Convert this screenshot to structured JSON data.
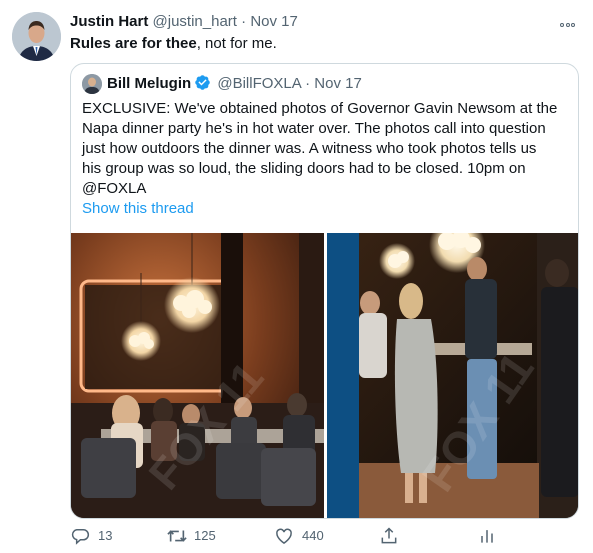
{
  "tweet": {
    "author_name": "Justin Hart",
    "author_handle": "@justin_hart",
    "separator": "·",
    "date": "Nov 17",
    "text_bold": "Rules are for thee",
    "text_rest": ", not for me."
  },
  "quoted": {
    "author_name": "Bill Melugin",
    "author_handle": "@BillFOXLA",
    "separator": "·",
    "date": "Nov 17",
    "verified": true,
    "text_lines": [
      "EXCLUSIVE: We've obtained photos of Governor Gavin Newsom at the",
      "Napa dinner party he's in hot water over. The photos call into question",
      "just how outdoors the dinner was. A witness who took photos tells us",
      "his group was so loud, the sliding doors had to be closed. 10pm on",
      "@FOXLA"
    ],
    "show_thread": "Show this thread",
    "photo_watermark": "FOX 11"
  },
  "actions": {
    "reply_count": "13",
    "retweet_count": "125",
    "like_count": "440"
  },
  "icons": {
    "more": "more-icon",
    "reply": "reply-icon",
    "retweet": "retweet-icon",
    "like": "heart-icon",
    "share": "share-icon",
    "analytics": "analytics-icon",
    "verified": "verified-badge-icon"
  },
  "colors": {
    "accent": "#1d9bf0",
    "secondary_text": "#536471",
    "border": "#cfd9de"
  }
}
